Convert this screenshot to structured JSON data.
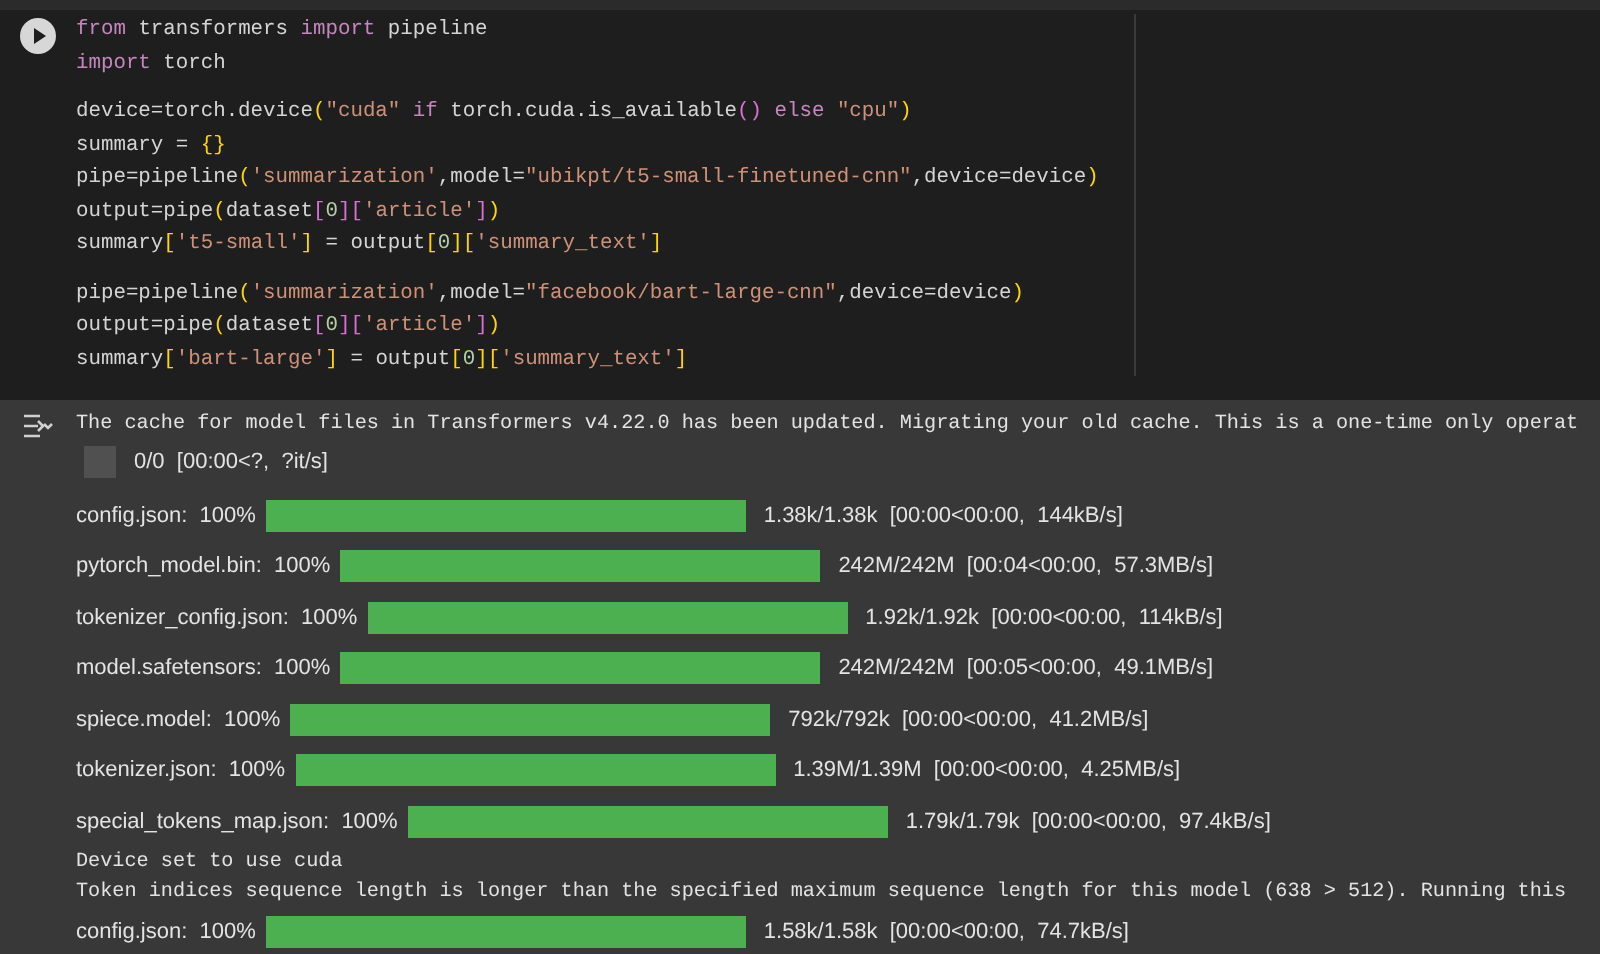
{
  "code_cell": {
    "blocks": [
      [
        [
          {
            "kind": "kw",
            "text": "from"
          },
          {
            "kind": "plain",
            "text": " transformers "
          },
          {
            "kind": "kw",
            "text": "import"
          },
          {
            "kind": "plain",
            "text": " pipeline"
          }
        ],
        [
          {
            "kind": "kw",
            "text": "import"
          },
          {
            "kind": "plain",
            "text": " torch"
          }
        ]
      ],
      [
        [
          {
            "kind": "plain",
            "text": "device=torch.device"
          },
          {
            "kind": "b1",
            "text": "("
          },
          {
            "kind": "str",
            "text": "\"cuda\""
          },
          {
            "kind": "kw",
            "text": " if"
          },
          {
            "kind": "plain",
            "text": " torch.cuda.is_available"
          },
          {
            "kind": "b2",
            "text": "()"
          },
          {
            "kind": "kw",
            "text": " else"
          },
          {
            "kind": "str",
            "text": " \"cpu\""
          },
          {
            "kind": "b1",
            "text": ")"
          }
        ],
        [
          {
            "kind": "plain",
            "text": "summary = "
          },
          {
            "kind": "b1",
            "text": "{}"
          }
        ],
        [
          {
            "kind": "plain",
            "text": "pipe=pipeline"
          },
          {
            "kind": "b1",
            "text": "("
          },
          {
            "kind": "str",
            "text": "'summarization'"
          },
          {
            "kind": "plain",
            "text": ",model="
          },
          {
            "kind": "str",
            "text": "\"ubikpt/t5-small-finetuned-cnn\""
          },
          {
            "kind": "plain",
            "text": ",device=device"
          },
          {
            "kind": "b1",
            "text": ")"
          }
        ],
        [
          {
            "kind": "plain",
            "text": "output=pipe"
          },
          {
            "kind": "b1",
            "text": "("
          },
          {
            "kind": "plain",
            "text": "dataset"
          },
          {
            "kind": "b2",
            "text": "["
          },
          {
            "kind": "num",
            "text": "0"
          },
          {
            "kind": "b2",
            "text": "]["
          },
          {
            "kind": "str",
            "text": "'article'"
          },
          {
            "kind": "b2",
            "text": "]"
          },
          {
            "kind": "b1",
            "text": ")"
          }
        ],
        [
          {
            "kind": "plain",
            "text": "summary"
          },
          {
            "kind": "b1",
            "text": "["
          },
          {
            "kind": "str",
            "text": "'t5-small'"
          },
          {
            "kind": "b1",
            "text": "]"
          },
          {
            "kind": "plain",
            "text": " = output"
          },
          {
            "kind": "b1",
            "text": "["
          },
          {
            "kind": "num",
            "text": "0"
          },
          {
            "kind": "b1",
            "text": "]["
          },
          {
            "kind": "str",
            "text": "'summary_text'"
          },
          {
            "kind": "b1",
            "text": "]"
          }
        ]
      ],
      [
        [
          {
            "kind": "plain",
            "text": "pipe=pipeline"
          },
          {
            "kind": "b1",
            "text": "("
          },
          {
            "kind": "str",
            "text": "'summarization'"
          },
          {
            "kind": "plain",
            "text": ",model="
          },
          {
            "kind": "str",
            "text": "\"facebook/bart-large-cnn\""
          },
          {
            "kind": "plain",
            "text": ",device=device"
          },
          {
            "kind": "b1",
            "text": ")"
          }
        ],
        [
          {
            "kind": "plain",
            "text": "output=pipe"
          },
          {
            "kind": "b1",
            "text": "("
          },
          {
            "kind": "plain",
            "text": "dataset"
          },
          {
            "kind": "b2",
            "text": "["
          },
          {
            "kind": "num",
            "text": "0"
          },
          {
            "kind": "b2",
            "text": "]["
          },
          {
            "kind": "str",
            "text": "'article'"
          },
          {
            "kind": "b2",
            "text": "]"
          },
          {
            "kind": "b1",
            "text": ")"
          }
        ],
        [
          {
            "kind": "plain",
            "text": "summary"
          },
          {
            "kind": "b1",
            "text": "["
          },
          {
            "kind": "str",
            "text": "'bart-large'"
          },
          {
            "kind": "b1",
            "text": "]"
          },
          {
            "kind": "plain",
            "text": " = output"
          },
          {
            "kind": "b1",
            "text": "["
          },
          {
            "kind": "num",
            "text": "0"
          },
          {
            "kind": "b1",
            "text": "]["
          },
          {
            "kind": "str",
            "text": "'summary_text'"
          },
          {
            "kind": "b1",
            "text": "]"
          }
        ]
      ]
    ]
  },
  "outputs": [
    {
      "kind": "text",
      "text": "The cache for model files in Transformers v4.22.0 has been updated. Migrating your old cache. This is a one-time only operat"
    },
    {
      "kind": "widget",
      "level": 0,
      "stats": "0/0  [00:00<?,  ?it/s]"
    },
    {
      "kind": "progress",
      "label": "config.json:  100%",
      "level": 1,
      "stats": "1.38k/1.38k  [00:00<00:00,  144kB/s]"
    },
    {
      "kind": "progress",
      "label": "pytorch_model.bin:  100%",
      "level": 1,
      "stats": "242M/242M  [00:04<00:00,  57.3MB/s]"
    },
    {
      "kind": "progress",
      "label": "tokenizer_config.json:  100%",
      "level": 1,
      "stats": "1.92k/1.92k  [00:00<00:00,  114kB/s]"
    },
    {
      "kind": "progress",
      "label": "model.safetensors:  100%",
      "level": 1,
      "stats": "242M/242M  [00:05<00:00,  49.1MB/s]"
    },
    {
      "kind": "progress",
      "label": "spiece.model:  100%",
      "level": 1,
      "stats": "792k/792k  [00:00<00:00,  41.2MB/s]"
    },
    {
      "kind": "progress",
      "label": "tokenizer.json:  100%",
      "level": 1,
      "stats": "1.39M/1.39M  [00:00<00:00,  4.25MB/s]"
    },
    {
      "kind": "progress",
      "label": "special_tokens_map.json:  100%",
      "level": 1,
      "stats": "1.79k/1.79k  [00:00<00:00,  97.4kB/s]"
    },
    {
      "kind": "text",
      "text": "Device set to use cuda"
    },
    {
      "kind": "text",
      "text": "Token indices sequence length is longer than the specified maximum sequence length for this model (638 > 512). Running this"
    },
    {
      "kind": "progress",
      "label": "config.json:  100%",
      "level": 1,
      "stats": "1.58k/1.58k  [00:00<00:00,  74.7kB/s]"
    }
  ]
}
